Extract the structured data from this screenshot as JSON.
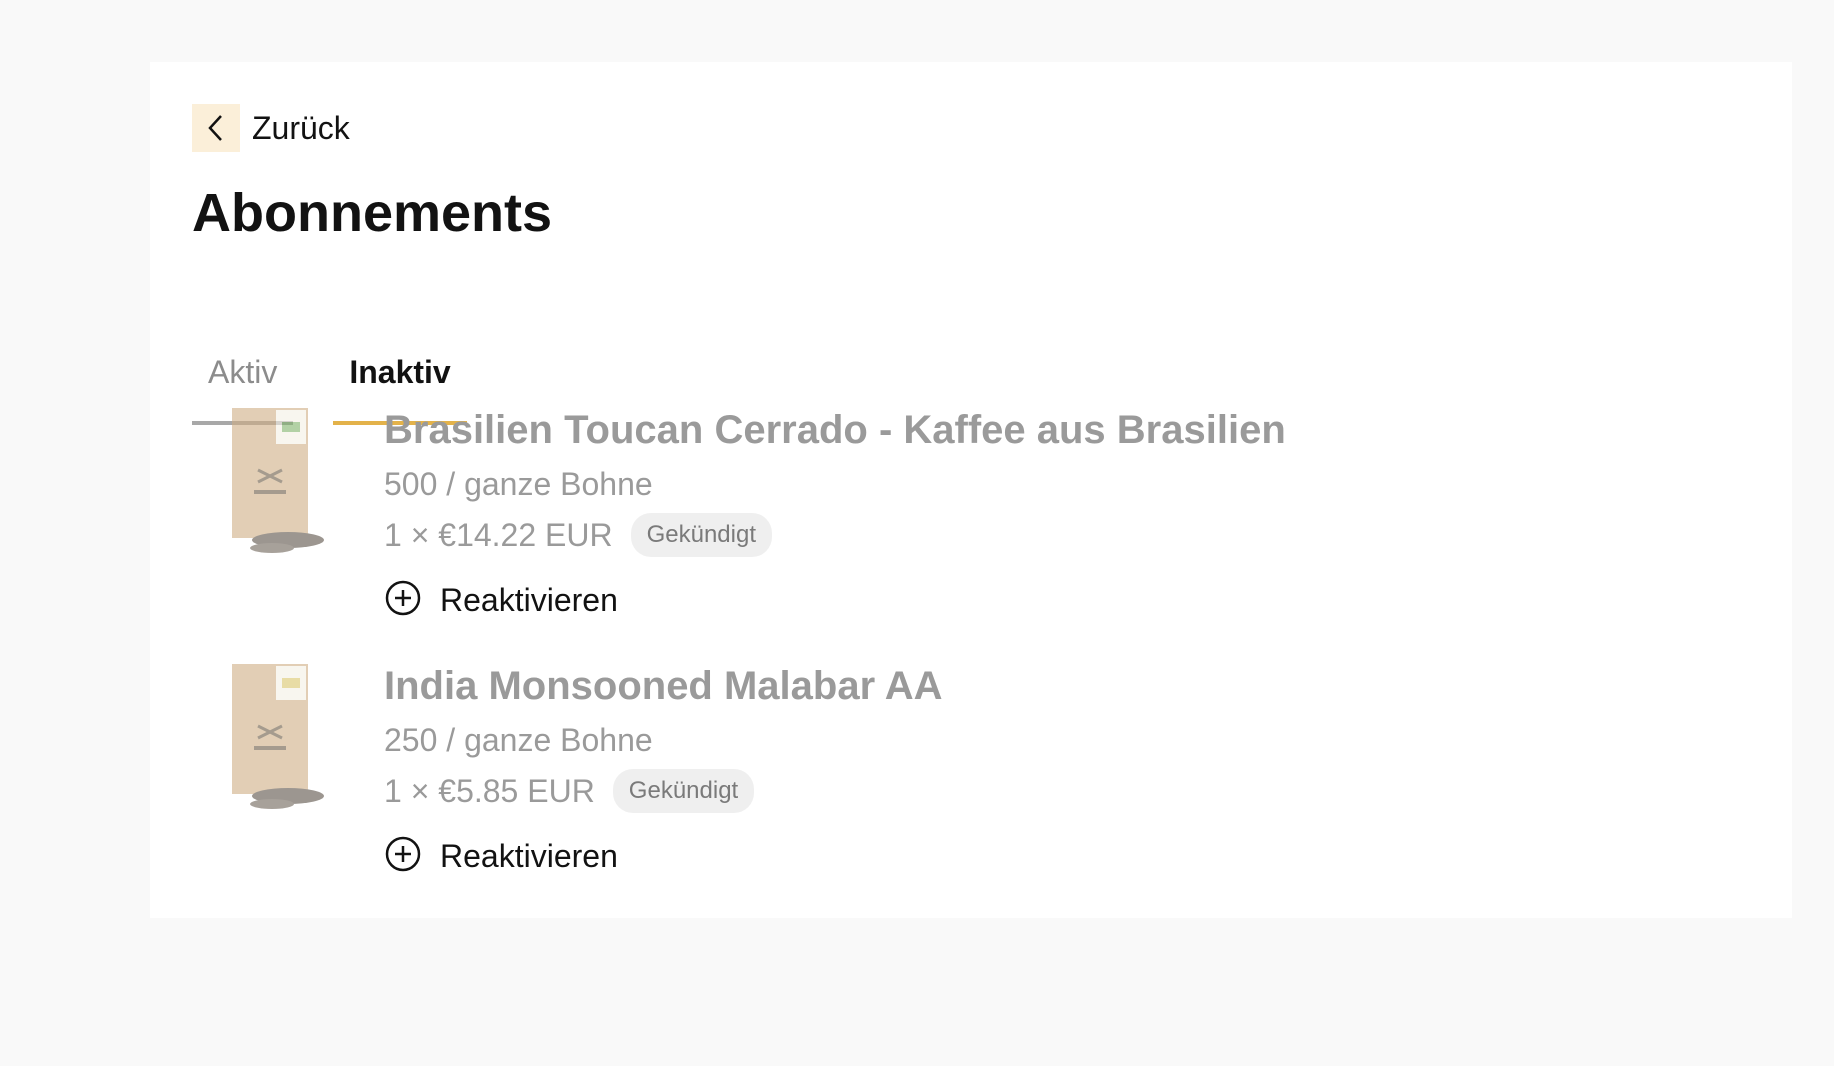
{
  "header": {
    "back_label": "Zurück",
    "page_title": "Abonnements"
  },
  "tabs": [
    {
      "label": "Aktiv",
      "active": false
    },
    {
      "label": "Inaktiv",
      "active": true
    }
  ],
  "subscriptions": [
    {
      "title": "Brasilien Toucan Cerrado - Kaffee aus Brasilien",
      "variant": "500 / ganze Bohne",
      "price": "1 × €14.22 EUR",
      "status": "Gekündigt",
      "action_label": "Reaktivieren"
    },
    {
      "title": "India Monsooned Malabar AA",
      "variant": "250 / ganze Bohne",
      "price": "1 × €5.85 EUR",
      "status": "Gekündigt",
      "action_label": "Reaktivieren"
    }
  ],
  "colors": {
    "accent": "#e3b24a",
    "back_bg": "#fbefd9",
    "muted_text": "#9a9a9a",
    "badge_bg": "#efefef"
  }
}
